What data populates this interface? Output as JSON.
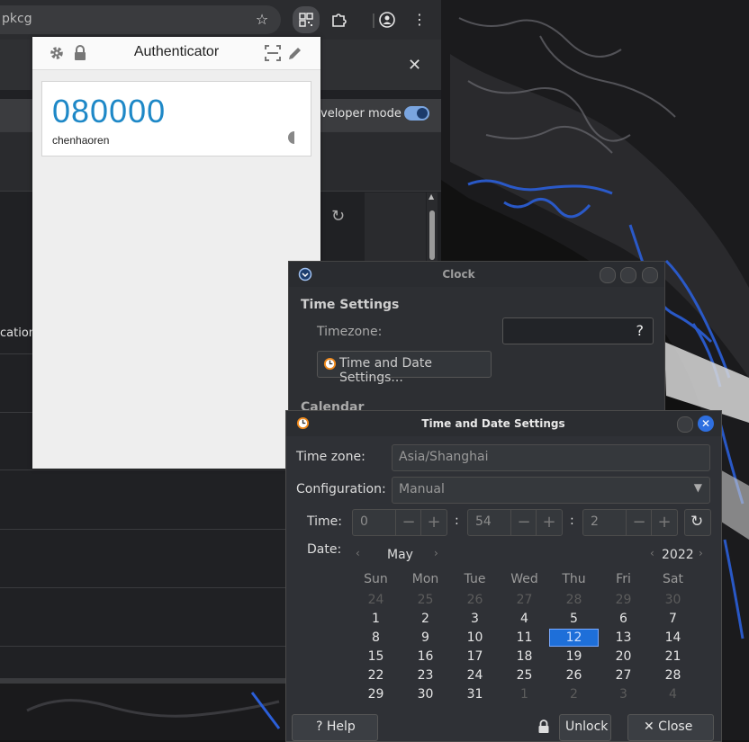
{
  "browser": {
    "url_fragment": "pkcg",
    "developer_mode_label": "veloper mode",
    "partial_label": "cation"
  },
  "authenticator": {
    "title": "Authenticator",
    "code": "080000",
    "account": "chenhaoren"
  },
  "clock": {
    "title": "Clock",
    "section_time": "Time Settings",
    "timezone_label": "Timezone:",
    "timezone_value": "?",
    "time_date_button": "Time and Date Settings...",
    "section_calendar": "Calendar"
  },
  "time_date_dialog": {
    "title": "Time and Date Settings",
    "timezone_label": "Time zone:",
    "timezone_value": "Asia/Shanghai",
    "configuration_label": "Configuration:",
    "configuration_value": "Manual",
    "time_label": "Time:",
    "hour": "0",
    "minute": "54",
    "second": "2",
    "date_label": "Date:",
    "month": "May",
    "year": "2022",
    "weekdays": [
      "Sun",
      "Mon",
      "Tue",
      "Wed",
      "Thu",
      "Fri",
      "Sat"
    ],
    "weeks": [
      [
        "24",
        "25",
        "26",
        "27",
        "28",
        "29",
        "30"
      ],
      [
        "1",
        "2",
        "3",
        "4",
        "5",
        "6",
        "7"
      ],
      [
        "8",
        "9",
        "10",
        "11",
        "12",
        "13",
        "14"
      ],
      [
        "15",
        "16",
        "17",
        "18",
        "19",
        "20",
        "21"
      ],
      [
        "22",
        "23",
        "24",
        "25",
        "26",
        "27",
        "28"
      ],
      [
        "29",
        "30",
        "31",
        "1",
        "2",
        "3",
        "4"
      ]
    ],
    "selected_day": "12",
    "help_button": "? Help",
    "unlock_button": "Unlock",
    "close_button": "✕ Close"
  }
}
